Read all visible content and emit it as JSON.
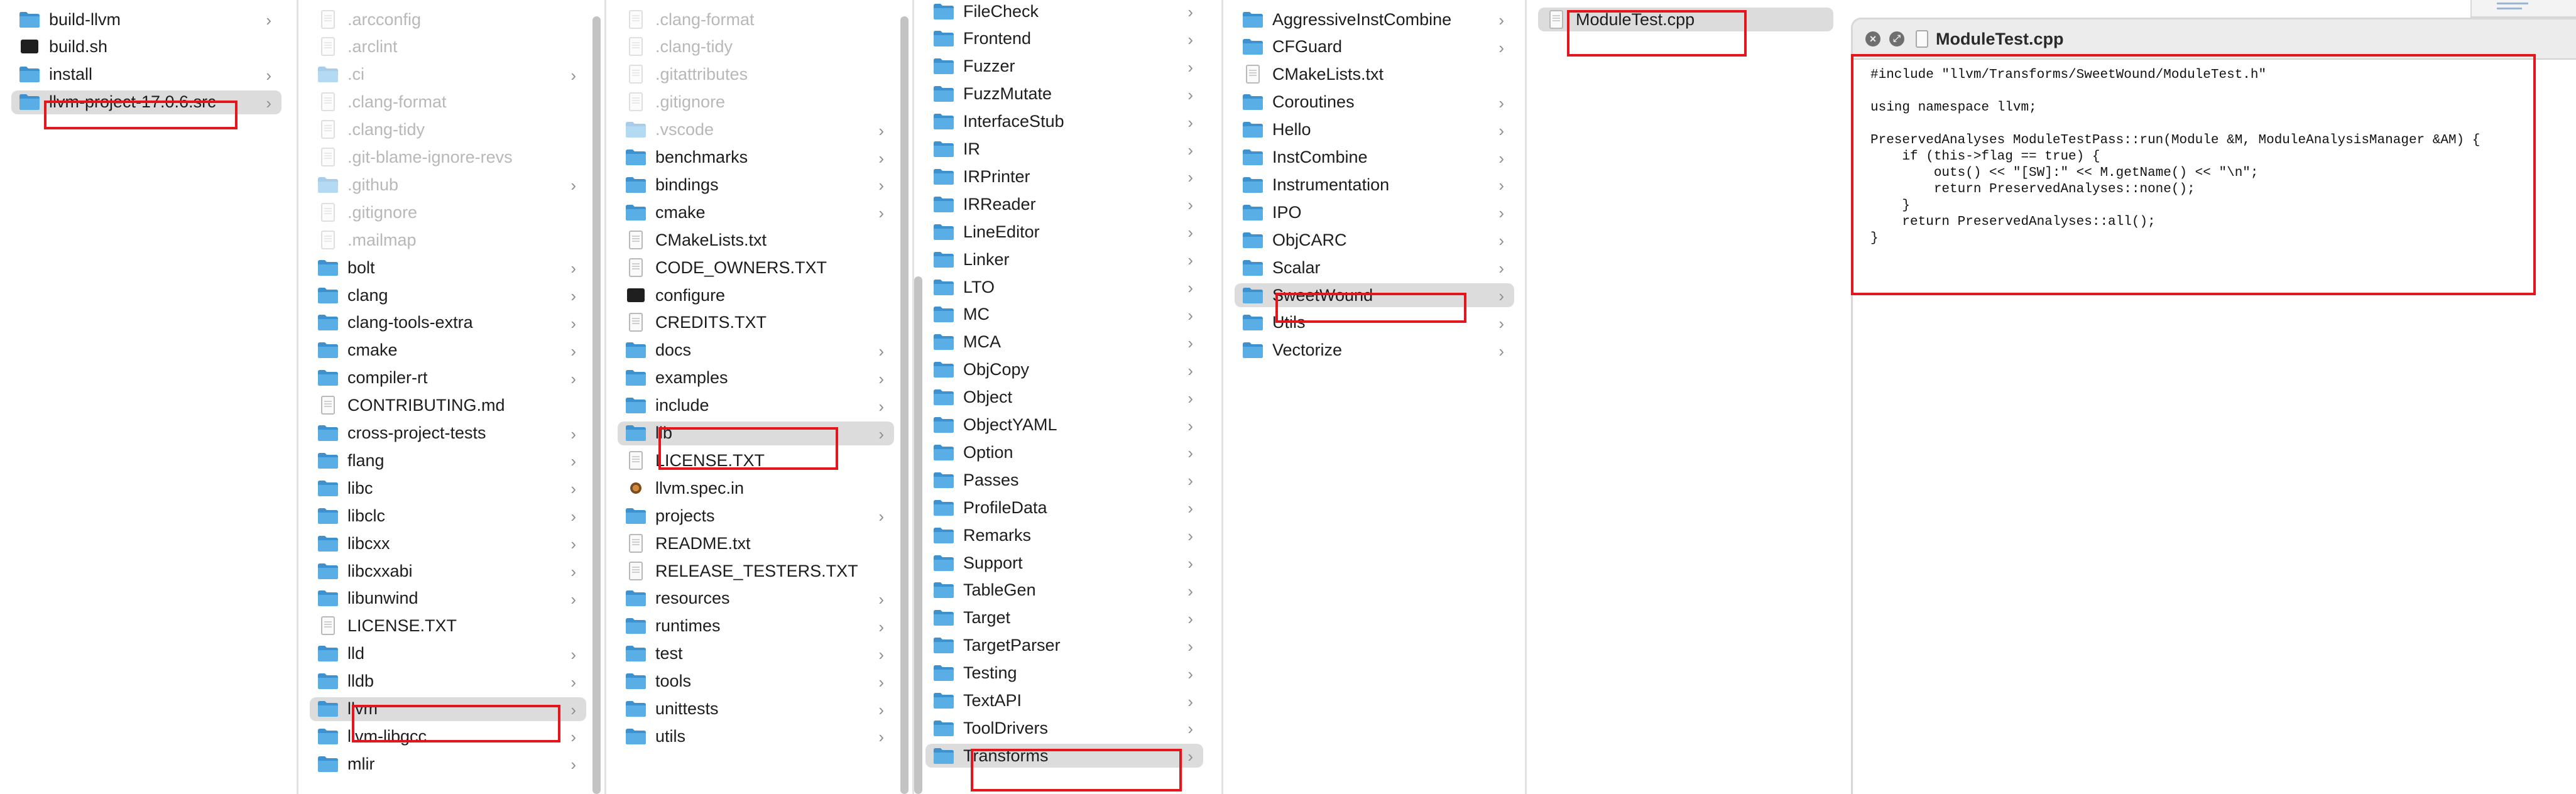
{
  "colors": {
    "folder": "#5aaee6",
    "selection": "#dcdcdc",
    "highlight": "#e3161d"
  },
  "columns": [
    {
      "id": "col1",
      "items": [
        {
          "name": "build-llvm",
          "kind": "folder",
          "chevron": true
        },
        {
          "name": "build.sh",
          "kind": "term"
        },
        {
          "name": "install",
          "kind": "folder",
          "chevron": true
        },
        {
          "name": "llvm-project-17.0.6.src",
          "kind": "folder",
          "chevron": true,
          "selected": true
        }
      ]
    },
    {
      "id": "col2",
      "items": [
        {
          "name": ".arcconfig",
          "kind": "doc",
          "hidden": true
        },
        {
          "name": ".arclint",
          "kind": "doc",
          "hidden": true
        },
        {
          "name": ".ci",
          "kind": "folder",
          "hidden": true,
          "chevron": true
        },
        {
          "name": ".clang-format",
          "kind": "doc",
          "hidden": true
        },
        {
          "name": ".clang-tidy",
          "kind": "doc",
          "hidden": true
        },
        {
          "name": ".git-blame-ignore-revs",
          "kind": "doc",
          "hidden": true
        },
        {
          "name": ".github",
          "kind": "folder",
          "hidden": true,
          "chevron": true
        },
        {
          "name": ".gitignore",
          "kind": "doc",
          "hidden": true
        },
        {
          "name": ".mailmap",
          "kind": "doc",
          "hidden": true
        },
        {
          "name": "bolt",
          "kind": "folder",
          "chevron": true
        },
        {
          "name": "clang",
          "kind": "folder",
          "chevron": true
        },
        {
          "name": "clang-tools-extra",
          "kind": "folder",
          "chevron": true
        },
        {
          "name": "cmake",
          "kind": "folder",
          "chevron": true
        },
        {
          "name": "compiler-rt",
          "kind": "folder",
          "chevron": true
        },
        {
          "name": "CONTRIBUTING.md",
          "kind": "doc"
        },
        {
          "name": "cross-project-tests",
          "kind": "folder",
          "chevron": true
        },
        {
          "name": "flang",
          "kind": "folder",
          "chevron": true
        },
        {
          "name": "libc",
          "kind": "folder",
          "chevron": true
        },
        {
          "name": "libclc",
          "kind": "folder",
          "chevron": true
        },
        {
          "name": "libcxx",
          "kind": "folder",
          "chevron": true
        },
        {
          "name": "libcxxabi",
          "kind": "folder",
          "chevron": true
        },
        {
          "name": "libunwind",
          "kind": "folder",
          "chevron": true
        },
        {
          "name": "LICENSE.TXT",
          "kind": "doc"
        },
        {
          "name": "lld",
          "kind": "folder",
          "chevron": true
        },
        {
          "name": "lldb",
          "kind": "folder",
          "chevron": true
        },
        {
          "name": "llvm",
          "kind": "folder",
          "chevron": true,
          "selected": true
        },
        {
          "name": "llvm-libgcc",
          "kind": "folder",
          "chevron": true
        },
        {
          "name": "mlir",
          "kind": "folder",
          "chevron": true
        }
      ]
    },
    {
      "id": "col3",
      "items": [
        {
          "name": ".clang-format",
          "kind": "doc",
          "hidden": true
        },
        {
          "name": ".clang-tidy",
          "kind": "doc",
          "hidden": true
        },
        {
          "name": ".gitattributes",
          "kind": "doc",
          "hidden": true
        },
        {
          "name": ".gitignore",
          "kind": "doc",
          "hidden": true
        },
        {
          "name": ".vscode",
          "kind": "folder",
          "hidden": true,
          "chevron": true
        },
        {
          "name": "benchmarks",
          "kind": "folder",
          "chevron": true
        },
        {
          "name": "bindings",
          "kind": "folder",
          "chevron": true
        },
        {
          "name": "cmake",
          "kind": "folder",
          "chevron": true
        },
        {
          "name": "CMakeLists.txt",
          "kind": "doc"
        },
        {
          "name": "CODE_OWNERS.TXT",
          "kind": "doc"
        },
        {
          "name": "configure",
          "kind": "term"
        },
        {
          "name": "CREDITS.TXT",
          "kind": "doc"
        },
        {
          "name": "docs",
          "kind": "folder",
          "chevron": true
        },
        {
          "name": "examples",
          "kind": "folder",
          "chevron": true
        },
        {
          "name": "include",
          "kind": "folder",
          "chevron": true
        },
        {
          "name": "lib",
          "kind": "folder",
          "chevron": true,
          "selected": true
        },
        {
          "name": "LICENSE.TXT",
          "kind": "doc"
        },
        {
          "name": "llvm.spec.in",
          "kind": "spec"
        },
        {
          "name": "projects",
          "kind": "folder",
          "chevron": true
        },
        {
          "name": "README.txt",
          "kind": "doc"
        },
        {
          "name": "RELEASE_TESTERS.TXT",
          "kind": "doc"
        },
        {
          "name": "resources",
          "kind": "folder",
          "chevron": true
        },
        {
          "name": "runtimes",
          "kind": "folder",
          "chevron": true
        },
        {
          "name": "test",
          "kind": "folder",
          "chevron": true
        },
        {
          "name": "tools",
          "kind": "folder",
          "chevron": true
        },
        {
          "name": "unittests",
          "kind": "folder",
          "chevron": true
        },
        {
          "name": "utils",
          "kind": "folder",
          "chevron": true
        }
      ]
    },
    {
      "id": "col4",
      "items": [
        {
          "name": "FileCheck",
          "kind": "folder",
          "chevron": true
        },
        {
          "name": "Frontend",
          "kind": "folder",
          "chevron": true
        },
        {
          "name": "Fuzzer",
          "kind": "folder",
          "chevron": true
        },
        {
          "name": "FuzzMutate",
          "kind": "folder",
          "chevron": true
        },
        {
          "name": "InterfaceStub",
          "kind": "folder",
          "chevron": true
        },
        {
          "name": "IR",
          "kind": "folder",
          "chevron": true
        },
        {
          "name": "IRPrinter",
          "kind": "folder",
          "chevron": true
        },
        {
          "name": "IRReader",
          "kind": "folder",
          "chevron": true
        },
        {
          "name": "LineEditor",
          "kind": "folder",
          "chevron": true
        },
        {
          "name": "Linker",
          "kind": "folder",
          "chevron": true
        },
        {
          "name": "LTO",
          "kind": "folder",
          "chevron": true
        },
        {
          "name": "MC",
          "kind": "folder",
          "chevron": true
        },
        {
          "name": "MCA",
          "kind": "folder",
          "chevron": true
        },
        {
          "name": "ObjCopy",
          "kind": "folder",
          "chevron": true
        },
        {
          "name": "Object",
          "kind": "folder",
          "chevron": true
        },
        {
          "name": "ObjectYAML",
          "kind": "folder",
          "chevron": true
        },
        {
          "name": "Option",
          "kind": "folder",
          "chevron": true
        },
        {
          "name": "Passes",
          "kind": "folder",
          "chevron": true
        },
        {
          "name": "ProfileData",
          "kind": "folder",
          "chevron": true
        },
        {
          "name": "Remarks",
          "kind": "folder",
          "chevron": true
        },
        {
          "name": "Support",
          "kind": "folder",
          "chevron": true
        },
        {
          "name": "TableGen",
          "kind": "folder",
          "chevron": true
        },
        {
          "name": "Target",
          "kind": "folder",
          "chevron": true
        },
        {
          "name": "TargetParser",
          "kind": "folder",
          "chevron": true
        },
        {
          "name": "Testing",
          "kind": "folder",
          "chevron": true
        },
        {
          "name": "TextAPI",
          "kind": "folder",
          "chevron": true
        },
        {
          "name": "ToolDrivers",
          "kind": "folder",
          "chevron": true
        },
        {
          "name": "Transforms",
          "kind": "folder",
          "chevron": true,
          "selected": true
        }
      ]
    },
    {
      "id": "col5",
      "items": [
        {
          "name": "AggressiveInstCombine",
          "kind": "folder",
          "chevron": true
        },
        {
          "name": "CFGuard",
          "kind": "folder",
          "chevron": true
        },
        {
          "name": "CMakeLists.txt",
          "kind": "doc"
        },
        {
          "name": "Coroutines",
          "kind": "folder",
          "chevron": true
        },
        {
          "name": "Hello",
          "kind": "folder",
          "chevron": true
        },
        {
          "name": "InstCombine",
          "kind": "folder",
          "chevron": true
        },
        {
          "name": "Instrumentation",
          "kind": "folder",
          "chevron": true
        },
        {
          "name": "IPO",
          "kind": "folder",
          "chevron": true
        },
        {
          "name": "ObjCARC",
          "kind": "folder",
          "chevron": true
        },
        {
          "name": "Scalar",
          "kind": "folder",
          "chevron": true
        },
        {
          "name": "SweetWound",
          "kind": "folder",
          "chevron": true,
          "selected": true
        },
        {
          "name": "Utils",
          "kind": "folder",
          "chevron": true
        },
        {
          "name": "Vectorize",
          "kind": "folder",
          "chevron": true
        }
      ]
    },
    {
      "id": "col6",
      "items": [
        {
          "name": "ModuleTest.cpp",
          "kind": "doc",
          "selected": true
        }
      ]
    }
  ],
  "preview": {
    "title": "ModuleTest.cpp",
    "close_glyph": "×",
    "fullscreen_glyph": "⤢",
    "code": "#include \"llvm/Transforms/SweetWound/ModuleTest.h\"\n\nusing namespace llvm;\n\nPreservedAnalyses ModuleTestPass::run(Module &M, ModuleAnalysisManager &AM) {\n    if (this->flag == true) {\n        outs() << \"[SW]:\" << M.getName() << \"\\n\";\n        return PreservedAnalyses::none();\n    }\n    return PreservedAnalyses::all();\n}"
  }
}
